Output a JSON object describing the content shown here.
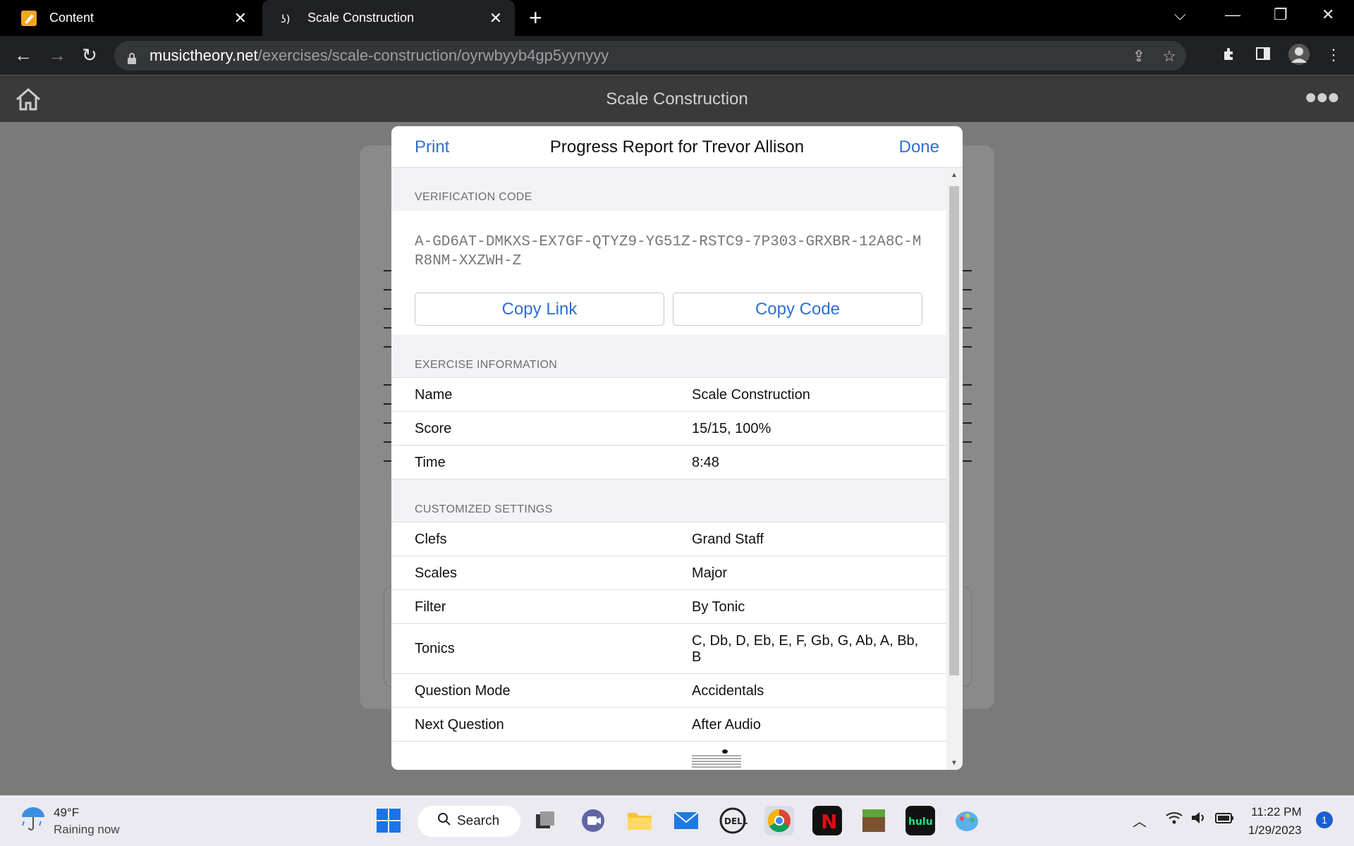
{
  "browser": {
    "tabs": [
      {
        "label": "Content",
        "icon": "pencil-icon"
      },
      {
        "label": "Scale Construction",
        "icon": "musictheory-icon"
      }
    ],
    "new_tab": "+",
    "url_host": "musictheory.net",
    "url_path": "/exercises/scale-construction/oyrwbyyb4gp5yynyyy"
  },
  "app": {
    "title": "Scale Construction"
  },
  "modal": {
    "print_label": "Print",
    "title": "Progress Report for Trevor Allison",
    "done_label": "Done",
    "verification": {
      "header": "VERIFICATION CODE",
      "code": "A-GD6AT-DMKXS-EX7GF-QTYZ9-YG51Z-RSTC9-7P303-GRXBR-12A8C-MR8NM-XXZWH-Z",
      "copy_link": "Copy Link",
      "copy_code": "Copy Code"
    },
    "exercise": {
      "header": "EXERCISE INFORMATION",
      "rows": [
        {
          "key": "Name",
          "value": "Scale Construction"
        },
        {
          "key": "Score",
          "value": "15/15, 100%"
        },
        {
          "key": "Time",
          "value": "8:48"
        }
      ]
    },
    "settings": {
      "header": "CUSTOMIZED SETTINGS",
      "rows": [
        {
          "key": "Clefs",
          "value": "Grand Staff"
        },
        {
          "key": "Scales",
          "value": "Major"
        },
        {
          "key": "Filter",
          "value": "By Tonic"
        },
        {
          "key": "Tonics",
          "value": "C, Db, D, Eb, E, F, Gb, G, Ab, A, Bb, B"
        },
        {
          "key": "Question Mode",
          "value": "Accidentals"
        },
        {
          "key": "Next Question",
          "value": "After Audio"
        }
      ]
    }
  },
  "taskbar": {
    "weather_temp": "49°F",
    "weather_desc": "Raining now",
    "search_label": "Search",
    "time": "11:22 PM",
    "date": "1/29/2023",
    "notifications": "1"
  }
}
